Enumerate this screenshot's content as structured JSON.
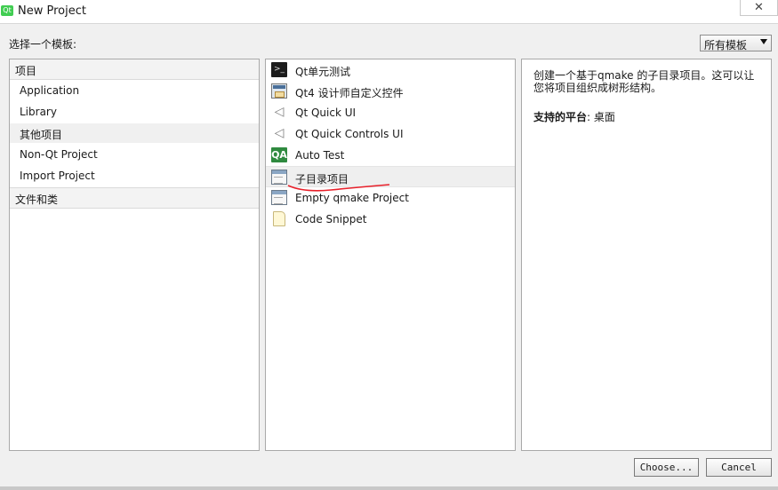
{
  "window": {
    "title": "New Project",
    "app_icon_label": "Qt",
    "close_symbol": "✕"
  },
  "selector": {
    "label": "选择一个模板:",
    "filter_value": "所有模板"
  },
  "categories": {
    "projects_header": "项目",
    "project_items": [
      "Application",
      "Library",
      "其他项目",
      "Non-Qt Project",
      "Import Project"
    ],
    "files_header": "文件和类",
    "selected_index": 2
  },
  "templates": {
    "items": [
      {
        "label": "Qt单元测试",
        "icon": "terminal-icon"
      },
      {
        "label": "Qt4 设计师自定义控件",
        "icon": "widget-icon"
      },
      {
        "label": "Qt Quick UI",
        "icon": "paper-plane-icon"
      },
      {
        "label": "Qt Quick Controls UI",
        "icon": "paper-plane-icon"
      },
      {
        "label": "Auto Test",
        "icon": "qa-icon"
      },
      {
        "label": "子目录项目",
        "icon": "window-icon"
      },
      {
        "label": "Empty qmake Project",
        "icon": "window-icon"
      },
      {
        "label": "Code Snippet",
        "icon": "document-icon"
      }
    ],
    "selected_index": 5,
    "qa_icon_text": "QA",
    "terminal_icon_text": ">_"
  },
  "description": {
    "text": "创建一个基于qmake 的子目录项目。这可以让您将项目组织成树形结构。",
    "platform_label": "支持的平台",
    "platform_value": ": 桌面"
  },
  "buttons": {
    "choose": "Choose...",
    "cancel": "Cancel"
  },
  "colors": {
    "annotation_red": "#e8202a",
    "qa_green": "#2f8a3f"
  }
}
